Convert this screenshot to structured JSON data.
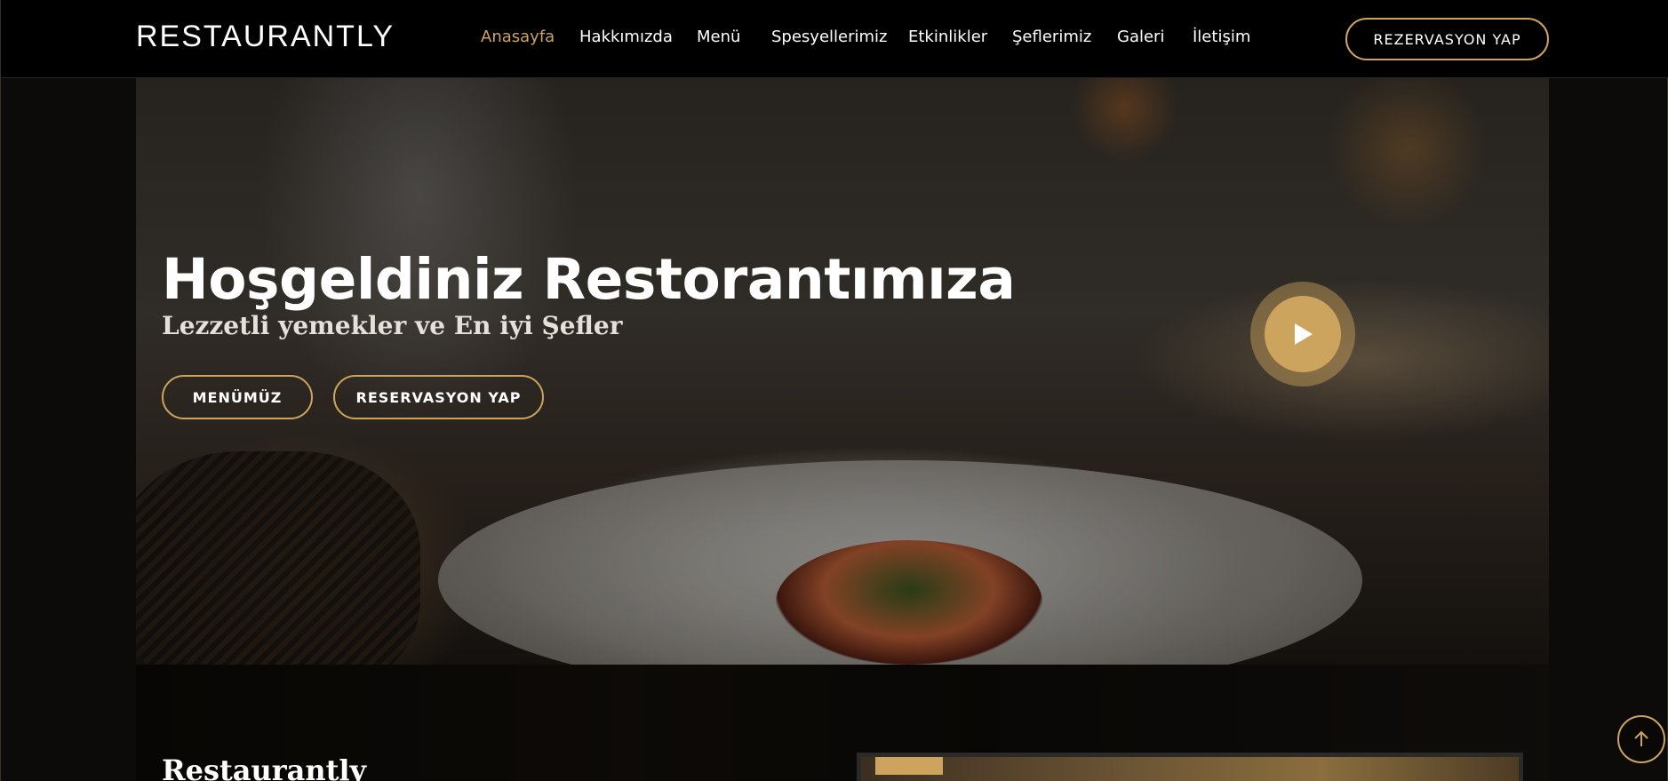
{
  "brand": {
    "name": "RESTAURANTLY",
    "accent_color": "#cda45e"
  },
  "nav": {
    "items": [
      {
        "label": "Anasayfa",
        "active": true
      },
      {
        "label": "Hakkımızda",
        "active": false
      },
      {
        "label": "Menü",
        "active": false
      },
      {
        "label": "Spesyellerimiz",
        "active": false
      },
      {
        "label": "Etkinlikler",
        "active": false
      },
      {
        "label": "Şeflerimiz",
        "active": false
      },
      {
        "label": "Galeri",
        "active": false
      },
      {
        "label": "İletişim",
        "active": false
      }
    ],
    "book_button": "REZERVASYON YAP"
  },
  "hero": {
    "title": "Hoşgeldiniz Restorantımıza",
    "subtitle": "Lezzetli yemekler ve En iyi Şefler",
    "menu_button": "MENÜMÜZ",
    "reserve_button": "RESERVASYON YAP",
    "play_icon": "play-icon"
  },
  "about": {
    "title": "Restaurantly"
  },
  "back_to_top_icon": "arrow-up-icon"
}
